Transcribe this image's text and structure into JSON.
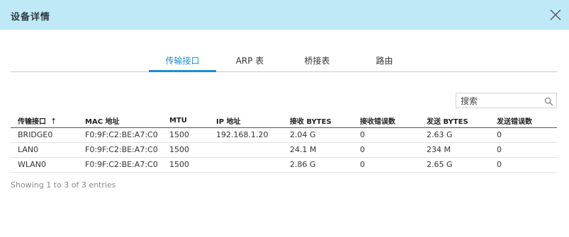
{
  "dialog": {
    "title": "设备详情",
    "close_icon": "close-icon"
  },
  "tabs": [
    {
      "label": "传输接口",
      "active": true
    },
    {
      "label": "ARP 表",
      "active": false
    },
    {
      "label": "桥接表",
      "active": false
    },
    {
      "label": "路由",
      "active": false
    }
  ],
  "search": {
    "placeholder": "搜索",
    "value": "",
    "icon": "search-icon"
  },
  "table": {
    "columns": [
      "传输接口",
      "MAC 地址",
      "MTU",
      "IP 地址",
      "接收 BYTES",
      "接收错误数",
      "发送 BYTES",
      "发送错误数"
    ],
    "sort": {
      "column": "传输接口",
      "direction": "↑"
    },
    "rows": [
      [
        "BRIDGE0",
        "F0:9F:C2:BE:A7:C0",
        "1500",
        "192.168.1.20",
        "2.04 G",
        "0",
        "2.63 G",
        "0"
      ],
      [
        "LAN0",
        "F0:9F:C2:BE:A7:C0",
        "1500",
        "",
        "24.1 M",
        "0",
        "234 M",
        "0"
      ],
      [
        "WLAN0",
        "F0:9F:C2:BE:A7:C0",
        "1500",
        "",
        "2.86 G",
        "0",
        "2.65 G",
        "0"
      ]
    ]
  },
  "footer": {
    "info": "Showing 1 to 3 of 3 entries"
  },
  "colors": {
    "header_bg": "#bfe9f6",
    "accent": "#1b8fd1"
  }
}
